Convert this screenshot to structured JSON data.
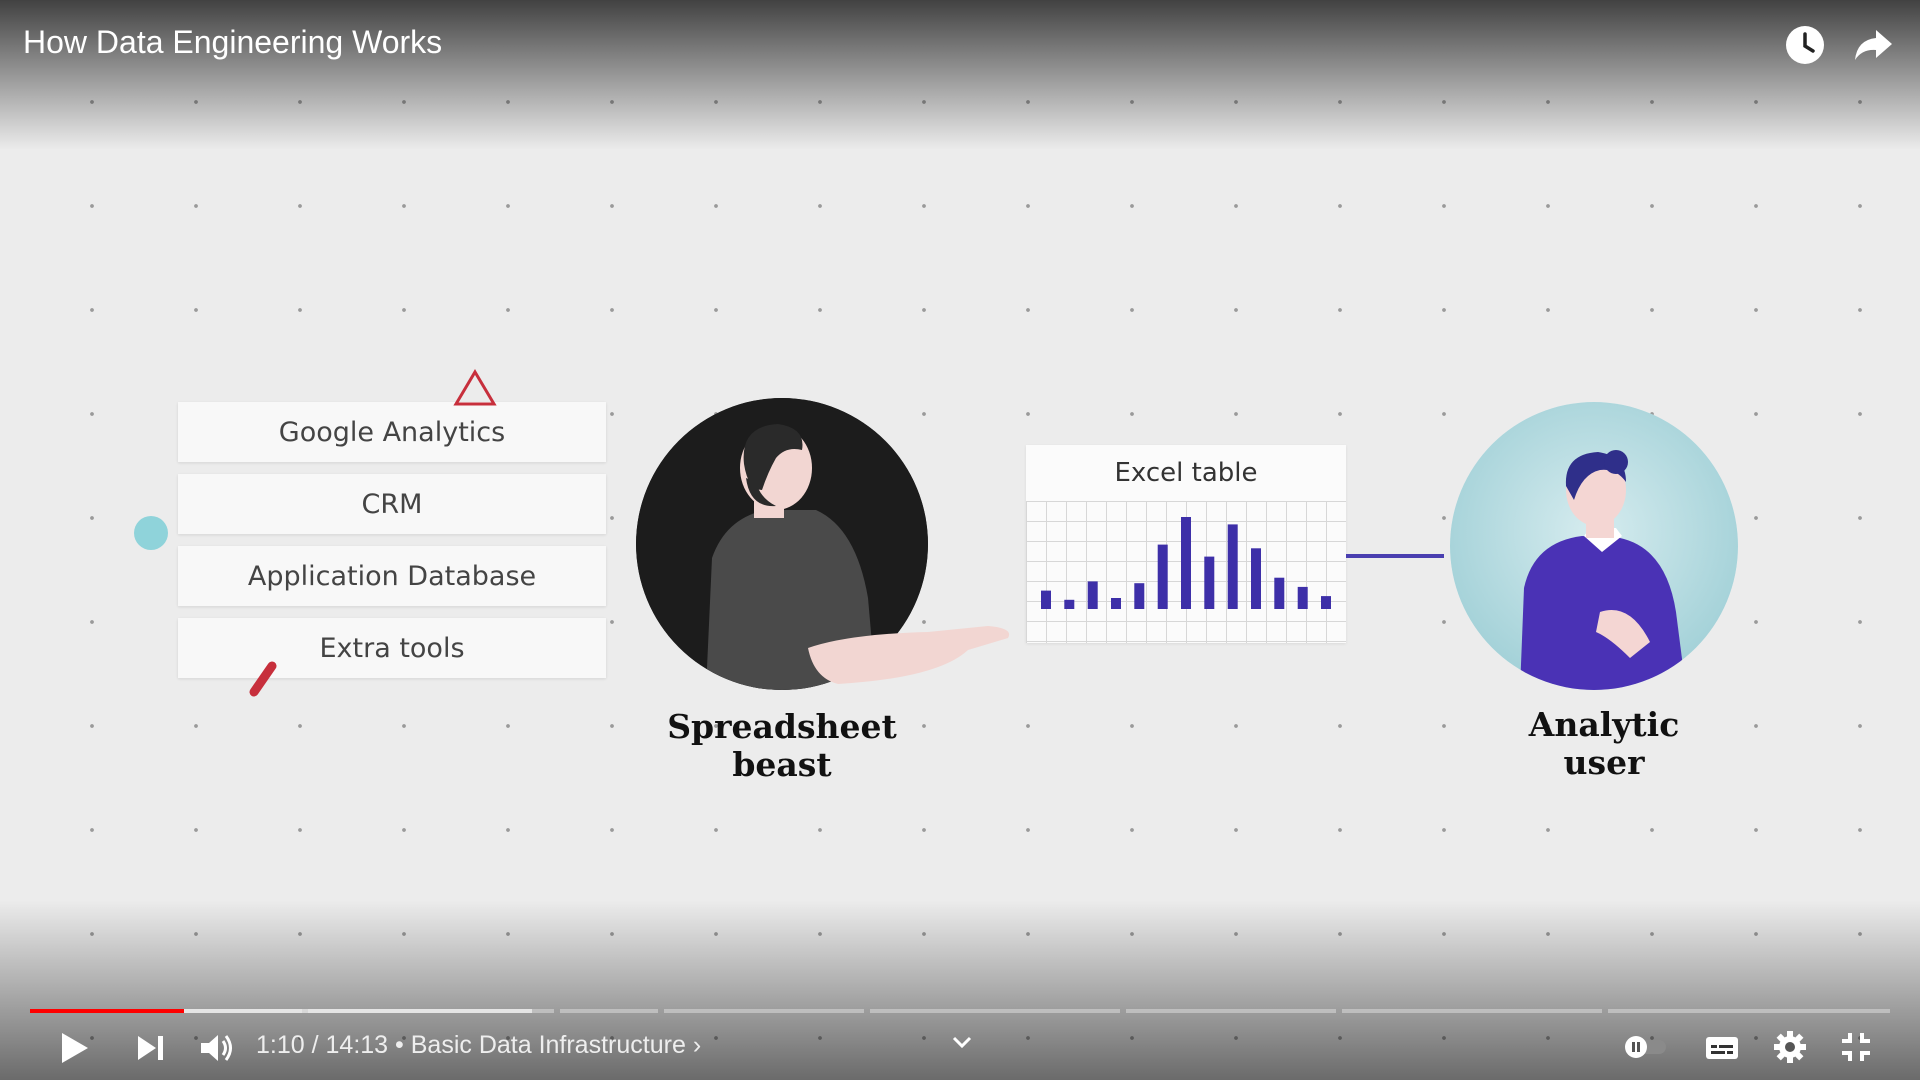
{
  "video": {
    "title": "How Data Engineering Works"
  },
  "top_actions": [
    {
      "name": "watch-later-icon"
    },
    {
      "name": "share-icon"
    }
  ],
  "scene": {
    "sources": [
      "Google Analytics",
      "CRM",
      "Application Database",
      "Extra tools"
    ],
    "character_left": {
      "line1": "Spreadsheet",
      "line2": "beast"
    },
    "character_right": {
      "line1": "Analytic",
      "line2": "user"
    },
    "excel": {
      "title": "Excel table",
      "bars": [
        0.2,
        0.1,
        0.3,
        0.12,
        0.28,
        0.7,
        1.0,
        0.57,
        0.92,
        0.66,
        0.34,
        0.24,
        0.14
      ]
    },
    "colors": {
      "bar": "#3d2fa8",
      "accent_teal": "#8fd3da",
      "accent_red": "#c72f3c",
      "user_shirt": "#4a32b5"
    }
  },
  "controls": {
    "current_time": "1:10",
    "separator": " / ",
    "duration": "14:13",
    "bullet": " • ",
    "chapter": "Basic Data Infrastructure",
    "chapter_arrow": "›",
    "progress_played_fraction": 0.083,
    "progress_buffer_fraction": 0.27
  }
}
